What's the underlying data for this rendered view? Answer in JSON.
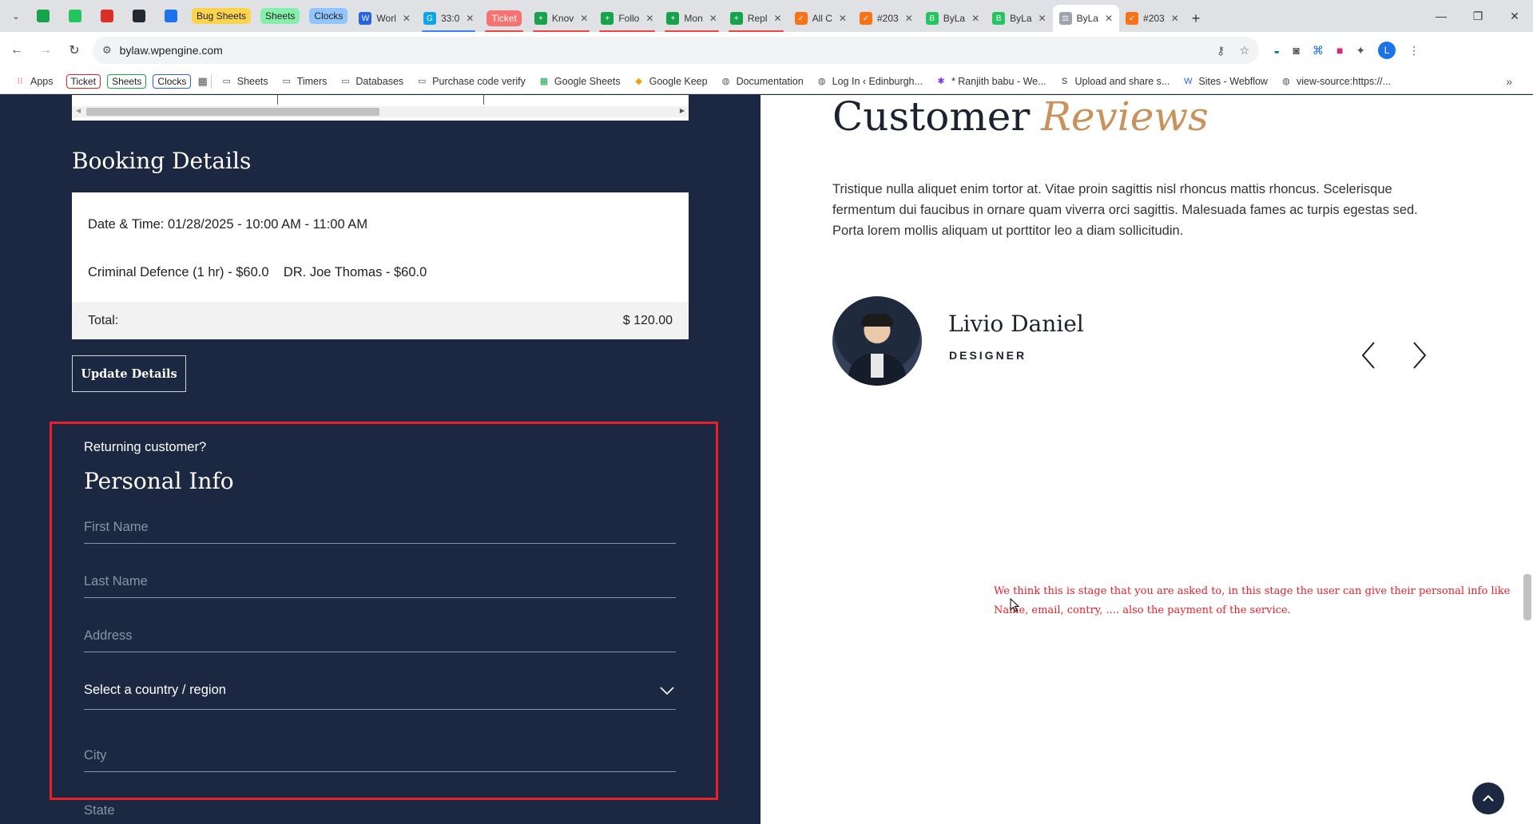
{
  "browser": {
    "pinned": [
      {
        "name": "sheets-green-icon",
        "color": "#16a34a"
      },
      {
        "name": "bylaw-green-icon",
        "color": "#22c55e"
      },
      {
        "name": "gmail-icon",
        "color": "#d93025"
      },
      {
        "name": "github-icon",
        "color": "#24292f"
      },
      {
        "name": "docs-icon",
        "color": "#1a73e8"
      }
    ],
    "group_chips": [
      {
        "label": "Bug Sheets",
        "bg": "#fcd34d"
      },
      {
        "label": "Sheets",
        "bg": "#86efac"
      },
      {
        "label": "Clocks",
        "bg": "#93c5fd"
      }
    ],
    "tabs": [
      {
        "title": "Worl",
        "fav": "W",
        "favColor": "#2563eb",
        "uline": ""
      },
      {
        "title": "33:0",
        "fav": "G",
        "favColor": "#0ea5e9",
        "uline": "#3b82f6"
      },
      {
        "title": "Ticket",
        "fav": "",
        "favColor": "",
        "uline": "#ef4444",
        "chip": true
      },
      {
        "title": "Knov",
        "fav": "+",
        "favColor": "#16a34a",
        "uline": "#ef4444"
      },
      {
        "title": "Follo",
        "fav": "+",
        "favColor": "#16a34a",
        "uline": "#ef4444"
      },
      {
        "title": "Mon",
        "fav": "+",
        "favColor": "#16a34a",
        "uline": "#ef4444"
      },
      {
        "title": "Repl",
        "fav": "+",
        "favColor": "#16a34a",
        "uline": "#ef4444"
      },
      {
        "title": "All C",
        "fav": "✓",
        "favColor": "#f97316",
        "uline": ""
      },
      {
        "title": "#203",
        "fav": "✓",
        "favColor": "#f97316",
        "uline": ""
      },
      {
        "title": "ByLa",
        "fav": "B",
        "favColor": "#22c55e",
        "uline": ""
      },
      {
        "title": "ByLa",
        "fav": "B",
        "favColor": "#22c55e",
        "uline": ""
      },
      {
        "title": "ByLa",
        "fav": "⚖",
        "favColor": "#9ca3af",
        "uline": "",
        "active": true
      },
      {
        "title": "#203",
        "fav": "✓",
        "favColor": "#f97316",
        "uline": ""
      }
    ],
    "url": "bylaw.wpengine.com",
    "profile_initial": "L"
  },
  "bookmarks": {
    "apps_label": "Apps",
    "chips": [
      {
        "label": "Ticket",
        "color": "#dc2626"
      },
      {
        "label": "Sheets",
        "color": "#16a34a"
      },
      {
        "label": "Clocks",
        "color": "#2563eb"
      }
    ],
    "items": [
      {
        "label": "Sheets",
        "icon": "folder-icon"
      },
      {
        "label": "Timers",
        "icon": "folder-icon"
      },
      {
        "label": "Databases",
        "icon": "folder-icon"
      },
      {
        "label": "Purchase code verify",
        "icon": "folder-icon"
      },
      {
        "label": "Google Sheets",
        "icon": "sheets-icon"
      },
      {
        "label": "Google Keep",
        "icon": "keep-icon"
      },
      {
        "label": "Documentation",
        "icon": "globe-icon"
      },
      {
        "label": "Log In ‹ Edinburgh...",
        "icon": "globe-icon"
      },
      {
        "label": "* Ranjith babu - We...",
        "icon": "slack-icon"
      },
      {
        "label": "Upload and share s...",
        "icon": "sb-icon"
      },
      {
        "label": "Sites - Webflow",
        "icon": "webflow-icon"
      },
      {
        "label": "view-source:https://...",
        "icon": "globe-icon"
      }
    ]
  },
  "booking": {
    "title": "Booking Details",
    "datetime": "Date & Time: 01/28/2025 - 10:00 AM - 11:00 AM",
    "service": "Criminal Defence (1 hr) - $60.0    DR. Joe Thomas - $60.0",
    "total_label": "Total:",
    "total_value": "$ 120.00",
    "update_button": "Update Details"
  },
  "personal_info": {
    "returning": "Returning customer?",
    "title": "Personal Info",
    "first_name": "First Name",
    "last_name": "Last Name",
    "address": "Address",
    "country": "Select a country / region",
    "city": "City",
    "state": "State"
  },
  "reviews": {
    "title_main": "Customer",
    "title_accent": "Reviews",
    "body": "Tristique nulla aliquet enim tortor at. Vitae proin sagittis nisl rhoncus mattis rhoncus. Scelerisque fermentum dui faucibus in ornare quam viverra orci sagittis. Malesuada fames ac turpis egestas sed. Porta lorem mollis aliquam ut porttitor leo a diam sollicitudin.",
    "reviewer_name": "Livio Daniel",
    "reviewer_role": "DESIGNER"
  },
  "annotation": "We think this is stage that you are asked to, in this stage the user can give their personal info like Name, email, contry, ....  also the payment of the service."
}
